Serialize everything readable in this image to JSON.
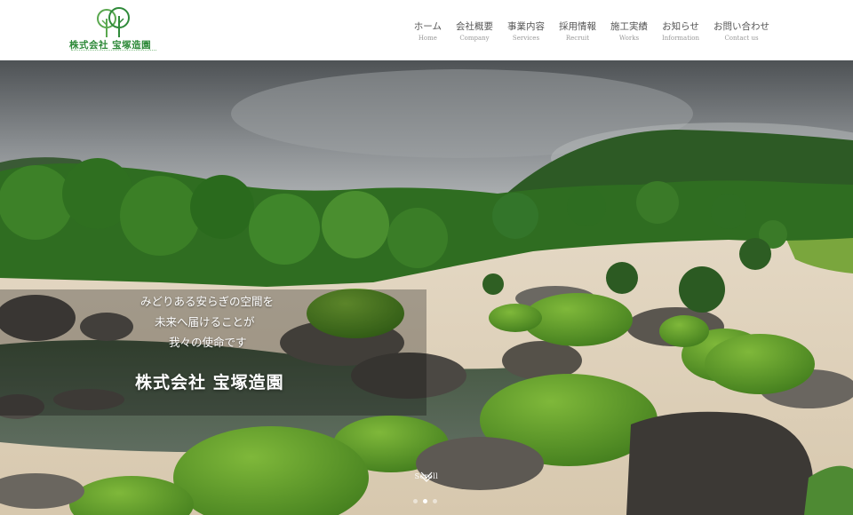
{
  "brand": {
    "name": "株式会社 宝塚造園",
    "color": "#2f8a3a"
  },
  "nav": [
    {
      "jp": "ホーム",
      "en": "Home"
    },
    {
      "jp": "会社概要",
      "en": "Company"
    },
    {
      "jp": "事業内容",
      "en": "Services"
    },
    {
      "jp": "採用情報",
      "en": "Recruit"
    },
    {
      "jp": "施工実績",
      "en": "Works"
    },
    {
      "jp": "お知らせ",
      "en": "Information"
    },
    {
      "jp": "お問い合わせ",
      "en": "Contact us"
    }
  ],
  "hero": {
    "tagline": [
      "みどりある安らぎの空間を",
      "未来へ届けることが",
      "我々の使命です"
    ],
    "company": "株式会社 宝塚造園",
    "scroll_label": "Scroll",
    "slides_total": 3,
    "slide_active": 2
  }
}
